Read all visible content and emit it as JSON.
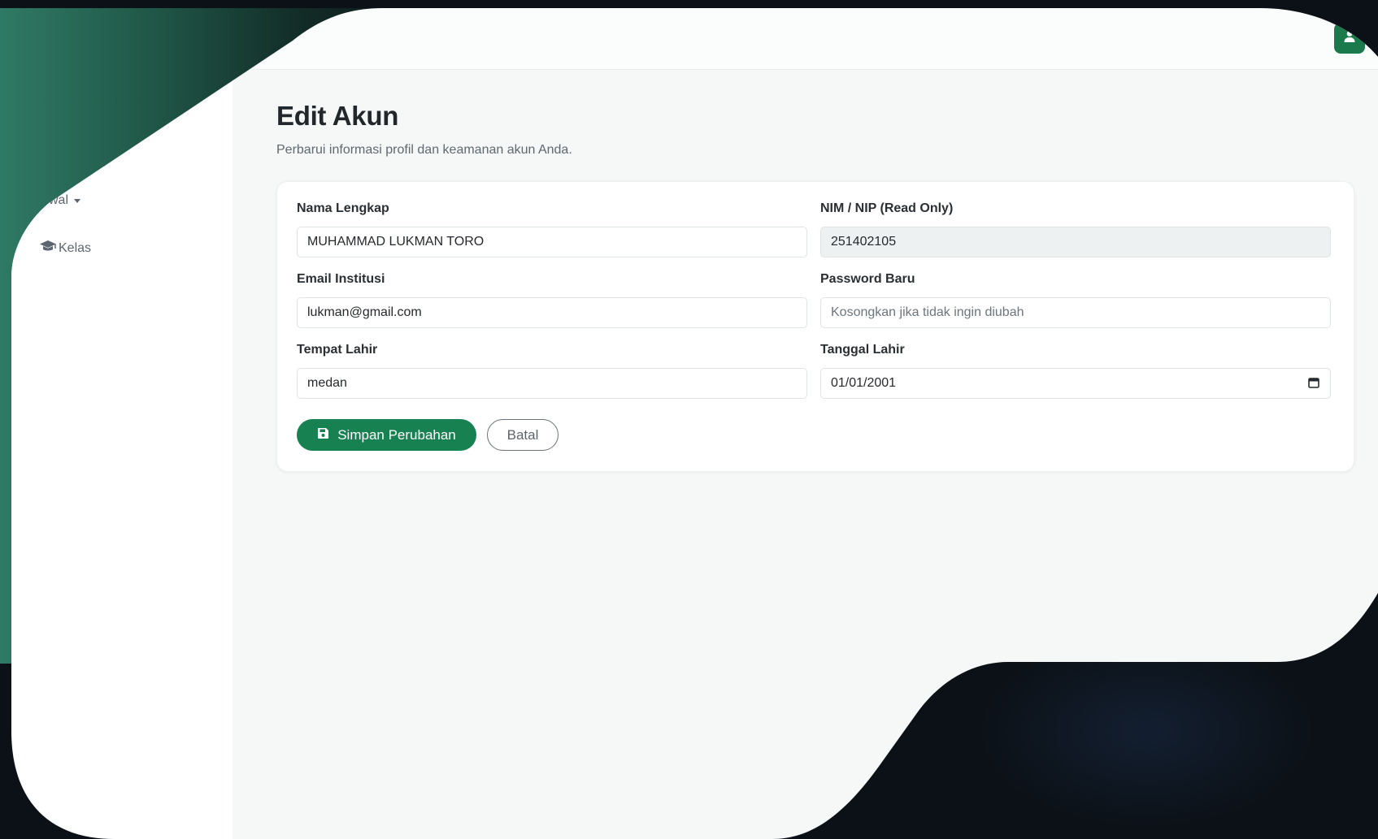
{
  "sidebar": {
    "items": [
      {
        "label": "wal",
        "icon": "chevron-down-icon"
      },
      {
        "label": "Kelas",
        "icon": "graduation-cap-icon"
      }
    ]
  },
  "topbar": {
    "user_icon": "user-icon",
    "accent_color": "#1a7a4c"
  },
  "page": {
    "title": "Edit Akun",
    "subtitle": "Perbarui informasi profil dan keamanan akun Anda."
  },
  "form": {
    "full_name": {
      "label": "Nama Lengkap",
      "value": "MUHAMMAD LUKMAN TORO"
    },
    "nim_nip": {
      "label": "NIM / NIP (Read Only)",
      "value": "251402105"
    },
    "email": {
      "label": "Email Institusi",
      "value": "lukman@gmail.com"
    },
    "password": {
      "label": "Password Baru",
      "value": "",
      "placeholder": "Kosongkan jika tidak ingin diubah"
    },
    "birth_place": {
      "label": "Tempat Lahir",
      "value": "medan"
    },
    "birth_date": {
      "label": "Tanggal Lahir",
      "value": "01/01/2001"
    },
    "save_label": "Simpan Perubahan",
    "cancel_label": "Batal",
    "save_icon": "floppy-disk-icon",
    "save_color": "#188151"
  }
}
